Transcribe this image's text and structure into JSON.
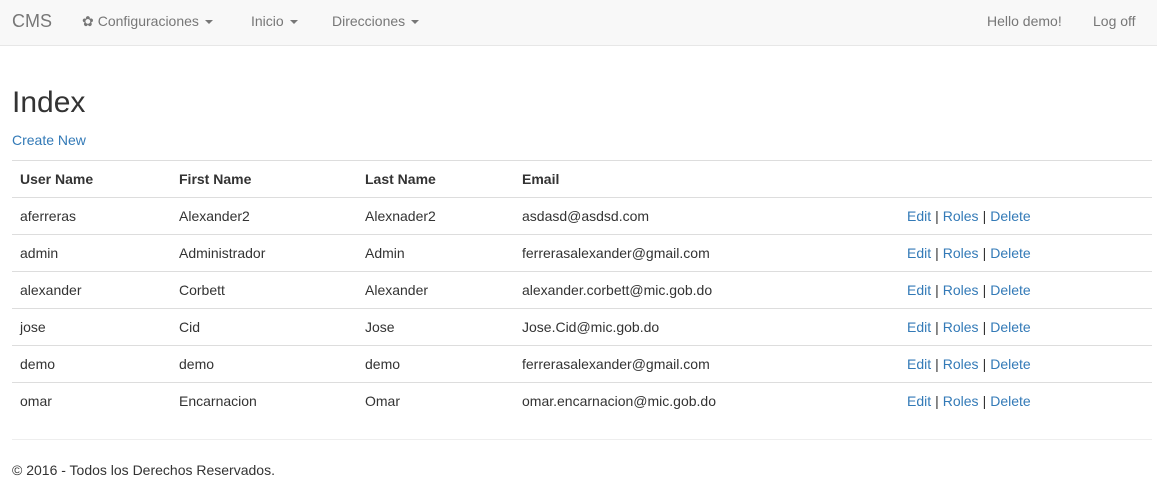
{
  "navbar": {
    "brand": "CMS",
    "menu": [
      {
        "label": "Configuraciones"
      },
      {
        "label": "Inicio"
      },
      {
        "label": "Direcciones"
      }
    ],
    "greeting": "Hello demo!",
    "logoff": "Log off"
  },
  "page": {
    "title": "Index",
    "create_new": "Create New"
  },
  "table": {
    "headers": [
      "User Name",
      "First Name",
      "Last Name",
      "Email"
    ],
    "rows": [
      {
        "user": "aferreras",
        "first": "Alexander2",
        "last": "Alexnader2",
        "email": "asdasd@asdsd.com"
      },
      {
        "user": "admin",
        "first": "Administrador",
        "last": "Admin",
        "email": "ferrerasalexander@gmail.com"
      },
      {
        "user": "alexander",
        "first": "Corbett",
        "last": "Alexander",
        "email": "alexander.corbett@mic.gob.do"
      },
      {
        "user": "jose",
        "first": "Cid",
        "last": "Jose",
        "email": "Jose.Cid@mic.gob.do"
      },
      {
        "user": "demo",
        "first": "demo",
        "last": "demo",
        "email": "ferrerasalexander@gmail.com"
      },
      {
        "user": "omar",
        "first": "Encarnacion",
        "last": "Omar",
        "email": "omar.encarnacion@mic.gob.do"
      }
    ],
    "actions": {
      "edit": "Edit",
      "roles": "Roles",
      "delete": "Delete",
      "separator": "|"
    }
  },
  "footer": {
    "text": "© 2016 - Todos los Derechos Reservados."
  },
  "colors": {
    "link": "#337ab7",
    "navbar_bg": "#f8f8f8"
  }
}
